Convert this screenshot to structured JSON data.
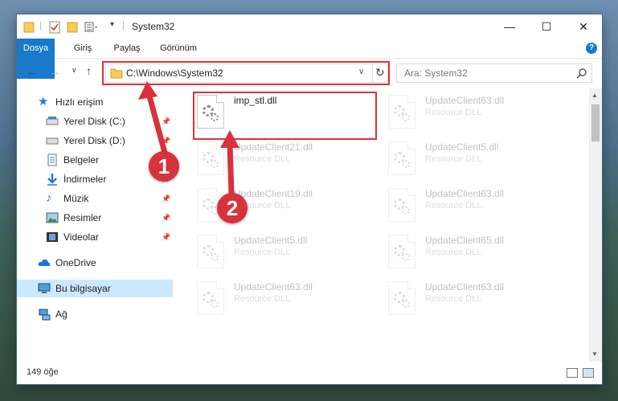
{
  "window": {
    "title": "System32"
  },
  "ribbon": {
    "tabs": [
      "Dosya",
      "Giriş",
      "Paylaş",
      "Görünüm"
    ],
    "help": "?"
  },
  "address": {
    "path": "C:\\Windows\\System32"
  },
  "search": {
    "placeholder": "Ara: System32"
  },
  "sidebar": {
    "items": [
      {
        "label": "Hızlı erişim",
        "icon": "star-icon"
      },
      {
        "label": "Yerel Disk (C:)",
        "icon": "drive-icon",
        "pinned": true
      },
      {
        "label": "Yerel Disk (D:)",
        "icon": "drive-icon",
        "pinned": true
      },
      {
        "label": "Belgeler",
        "icon": "documents-icon",
        "pinned": true
      },
      {
        "label": "İndirmeler",
        "icon": "download-icon",
        "pinned": true
      },
      {
        "label": "Müzik",
        "icon": "music-icon",
        "pinned": true
      },
      {
        "label": "Resimler",
        "icon": "pictures-icon",
        "pinned": true
      },
      {
        "label": "Videolar",
        "icon": "video-icon",
        "pinned": true
      },
      {
        "label": "OneDrive",
        "icon": "cloud-icon"
      },
      {
        "label": "Bu bilgisayar",
        "icon": "computer-icon",
        "selected": true
      },
      {
        "label": "Ağ",
        "icon": "network-icon"
      }
    ]
  },
  "files": [
    {
      "name": "imp_stl.dll",
      "desc": ""
    },
    {
      "name": "UpdateClient63.dll",
      "desc": "Resource DLL"
    },
    {
      "name": "UpdateClient21.dll",
      "desc": "Resource DLL"
    },
    {
      "name": "UpdateClient5.dll",
      "desc": "Resource DLL"
    },
    {
      "name": "UpdateClient19.dll",
      "desc": "Resource DLL"
    },
    {
      "name": "UpdateClient63.dll",
      "desc": "Resource DLL"
    },
    {
      "name": "UpdateClient5.dll",
      "desc": "Resource DLL"
    },
    {
      "name": "UpdateClient65.dll",
      "desc": "Resource DLL"
    },
    {
      "name": "UpdateClient63.dll",
      "desc": "Resource DLL"
    },
    {
      "name": "UpdateClient63.dll",
      "desc": "Resource DLL"
    }
  ],
  "status": {
    "count": "149 öğe"
  },
  "annotations": {
    "badge1": "1",
    "badge2": "2"
  },
  "colors": {
    "accent": "#1979ca",
    "highlight": "#e0303a",
    "selected": "#cce8ff"
  }
}
